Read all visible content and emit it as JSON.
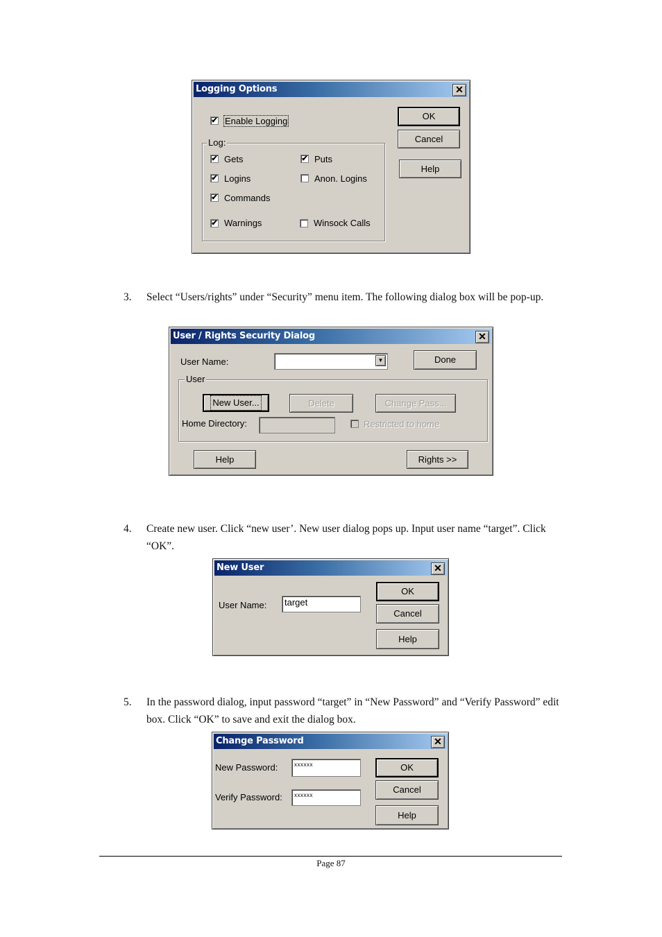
{
  "logging_dialog": {
    "title": "Logging Options",
    "enable_logging": {
      "label": "Enable Logging",
      "checked": true
    },
    "log_group_label": "Log:",
    "options": [
      {
        "label": "Gets",
        "checked": true
      },
      {
        "label": "Puts",
        "checked": true
      },
      {
        "label": "Logins",
        "checked": true
      },
      {
        "label": "Anon. Logins",
        "checked": false
      },
      {
        "label": "Commands",
        "checked": true
      },
      {
        "label": "Warnings",
        "checked": true
      },
      {
        "label": "Winsock Calls",
        "checked": false
      }
    ],
    "buttons": {
      "ok": "OK",
      "cancel": "Cancel",
      "help": "Help"
    },
    "close_glyph": "✕"
  },
  "steps": [
    {
      "number": "3.",
      "text": "Select “Users/rights” under “Security” menu item. The following dialog box will be pop-up."
    },
    {
      "number": "4.",
      "text": "Create new user. Click “new user’. New user dialog pops up. Input user name “target”. Click “OK”."
    },
    {
      "number": "5.",
      "text": "In the password dialog, input password “target” in “New Password” and   “Verify Password” edit box. Click “OK” to save and exit the dialog box."
    }
  ],
  "users_dialog": {
    "title": "User / Rights Security Dialog",
    "user_name_label": "User Name:",
    "user_name_value": "",
    "done": "Done",
    "group_label": "User",
    "new_user": "New User...",
    "delete": "Delete",
    "change_pass": "Change Pass...",
    "home_dir_label": "Home Directory:",
    "home_dir_value": "",
    "restricted_label": "Restricted to home",
    "restricted_checked": false,
    "help": "Help",
    "rights": "Rights >>",
    "close_glyph": "✕",
    "dropdown_glyph": "▼"
  },
  "new_user_dialog": {
    "title": "New User",
    "user_name_label": "User Name:",
    "user_name_value": "target",
    "ok": "OK",
    "cancel": "Cancel",
    "help": "Help",
    "close_glyph": "✕"
  },
  "change_password_dialog": {
    "title": "Change Password",
    "new_password_label": "New Password:",
    "new_password_value": "xxxxxx",
    "verify_password_label": "Verify Password:",
    "verify_password_value": "xxxxxx",
    "ok": "OK",
    "cancel": "Cancel",
    "help": "Help",
    "close_glyph": "✕"
  },
  "footer": {
    "page_label": "Page 87"
  },
  "check_glyph": "✔"
}
